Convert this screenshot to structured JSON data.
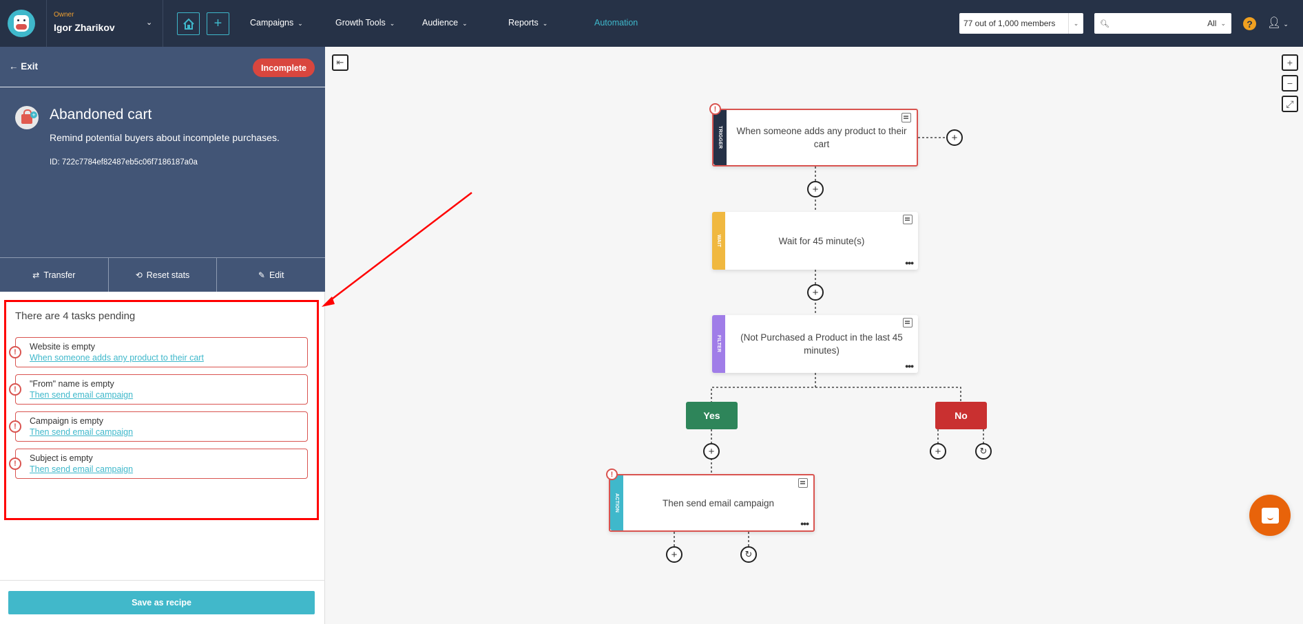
{
  "topnav": {
    "owner_label": "Owner",
    "owner_name": "Igor Zharikov",
    "home_icon": "home-icon",
    "add_icon": "plus-icon",
    "items": [
      {
        "label": "Campaigns",
        "has_dropdown": true
      },
      {
        "label": "Growth Tools",
        "has_dropdown": true
      },
      {
        "label": "Audience",
        "has_dropdown": true
      },
      {
        "label": "Reports",
        "has_dropdown": true
      },
      {
        "label": "Automation",
        "has_dropdown": false,
        "active": true
      }
    ],
    "members": "77 out of 1,000 members",
    "search": {
      "placeholder": "",
      "value": "",
      "scope": "All"
    },
    "help": "?"
  },
  "sidebar": {
    "exit_label": "Exit",
    "status_badge": "Incomplete",
    "title": "Abandoned cart",
    "description": "Remind potential buyers about incomplete purchases.",
    "id_text": "ID: 722c7784ef82487eb5c06f7186187a0a",
    "actions": [
      {
        "label": "Transfer",
        "icon": "transfer-icon"
      },
      {
        "label": "Reset stats",
        "icon": "history-icon"
      },
      {
        "label": "Edit",
        "icon": "pencil-icon"
      }
    ],
    "pending_title": "There are 4 tasks pending",
    "tasks": [
      {
        "issue": "Website is empty",
        "link": "When someone adds any product to their cart"
      },
      {
        "issue": "\"From\" name is empty",
        "link": "Then send email campaign"
      },
      {
        "issue": "Campaign is empty",
        "link": "Then send email campaign"
      },
      {
        "issue": "Subject is empty",
        "link": "Then send email campaign"
      }
    ],
    "save_recipe": "Save as recipe"
  },
  "canvas": {
    "nodes": [
      {
        "type": "TRIGGER",
        "label": "When someone adds any product to their cart",
        "color": "#263247",
        "error": true
      },
      {
        "type": "WAIT",
        "label": "Wait for 45 minute(s)",
        "color": "#f0b840",
        "error": false
      },
      {
        "type": "FILTER",
        "label": "(Not Purchased a Product in the last 45 minutes)",
        "color": "#a07de8",
        "error": false
      },
      {
        "type": "ACTION",
        "label": "Then send email campaign",
        "color": "#3fb8cb",
        "error": true
      }
    ],
    "branches": {
      "yes": "Yes",
      "no": "No",
      "yes_color": "#2e855a",
      "no_color": "#c93030"
    },
    "zoom_controls": [
      "+",
      "−",
      "⤢"
    ]
  },
  "colors": {
    "accent": "#3fb8cb",
    "error": "#d9534f",
    "nav_bg": "#263247",
    "panel_bg": "#425576",
    "annotation": "#ff0000"
  }
}
